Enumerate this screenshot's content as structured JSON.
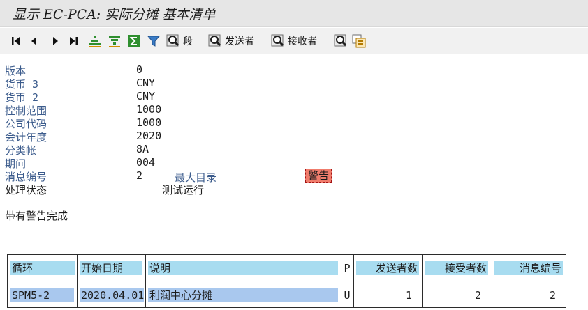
{
  "title": "显示 EC-PCA: 实际分摊 基本清单",
  "toolbar": {
    "segment_label": "段",
    "sender_label": "发送者",
    "receiver_label": "接收者"
  },
  "fields": {
    "version": {
      "label": "版本",
      "value": "0"
    },
    "currency3": {
      "label": "货币 3",
      "value": "CNY"
    },
    "currency2": {
      "label": "货币 2",
      "value": "CNY"
    },
    "controlling_area": {
      "label": "控制范围",
      "value": "1000"
    },
    "company_code": {
      "label": "公司代码",
      "value": "1000"
    },
    "fiscal_year": {
      "label": "会计年度",
      "value": "2020"
    },
    "ledger": {
      "label": "分类帐",
      "value": "8A"
    },
    "period": {
      "label": "期间",
      "value": "004"
    },
    "message_no": {
      "label": "消息编号",
      "value": "2"
    }
  },
  "max_directory_label": "最大目录",
  "warning_badge": "警告",
  "processing_status": {
    "label": "处理状态",
    "value": "测试运行"
  },
  "completion_message": "带有警告完成",
  "table": {
    "headers": {
      "cycle": "循环",
      "start_date": "开始日期",
      "description": "说明",
      "p": "P",
      "sender_count": "发送者数",
      "receiver_count": "接受者数",
      "message_no": "消息编号"
    },
    "rows": [
      {
        "cycle": "SPM5-2",
        "start_date": "2020.04.01",
        "description": "利润中心分摊",
        "p": "U",
        "sender_count": "1",
        "receiver_count": "2",
        "message_no": "2"
      }
    ]
  },
  "colors": {
    "label_blue": "#3b5b8c",
    "header_cyan": "#a8dcf0",
    "selected_cell": "#a9c8ee",
    "warning_red": "#f07c6c"
  }
}
